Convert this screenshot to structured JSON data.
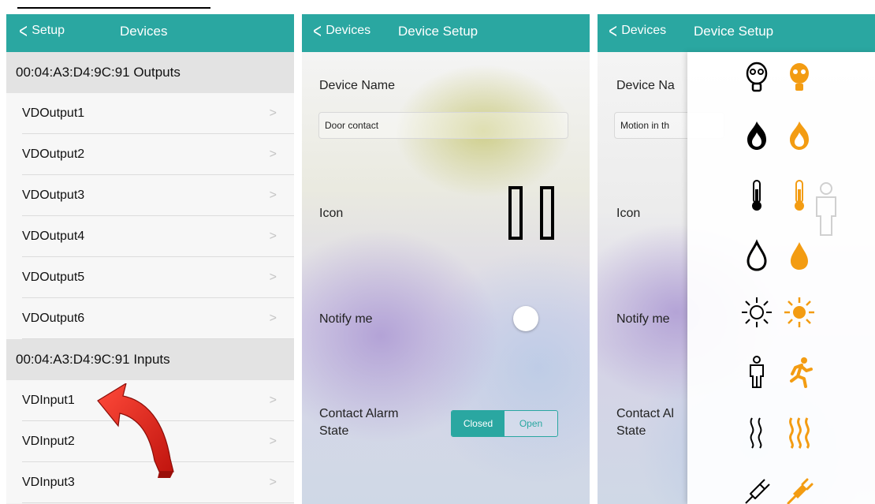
{
  "colors": {
    "accent": "#2aa7a1",
    "orange": "#f39c12",
    "arrow_red": "#e2231a"
  },
  "panel1": {
    "back_label": "Setup",
    "title": "Devices",
    "outputs_header": "00:04:A3:D4:9C:91 Outputs",
    "outputs": [
      "VDOutput1",
      "VDOutput2",
      "VDOutput3",
      "VDOutput4",
      "VDOutput5",
      "VDOutput6"
    ],
    "inputs_header": "00:04:A3:D4:9C:91 Inputs",
    "inputs": [
      "VDInput1",
      "VDInput2",
      "VDInput3"
    ],
    "chevron": ">"
  },
  "panel2": {
    "back_label": "Devices",
    "title": "Device Setup",
    "device_name_label": "Device Name",
    "device_name_value": "Door contact",
    "icon_label": "Icon",
    "notify_label": "Notify me",
    "alarm_label_line1": "Contact Alarm",
    "alarm_label_line2": "State",
    "seg_closed": "Closed",
    "seg_open": "Open"
  },
  "panel3": {
    "back_label": "Devices",
    "title": "Device Setup",
    "device_name_label": "Device Na",
    "device_name_value": "Motion in th",
    "icon_label": "Icon",
    "notify_label": "Notify me",
    "alarm_label_line1": "Contact Al",
    "alarm_label_line2": "State",
    "picker_icons": [
      "gas-mask-icon",
      "fire-icon",
      "thermometer-icon",
      "water-drop-icon",
      "sun-icon",
      "person-motion-icon",
      "heat-waves-icon",
      "plug-icon"
    ]
  }
}
